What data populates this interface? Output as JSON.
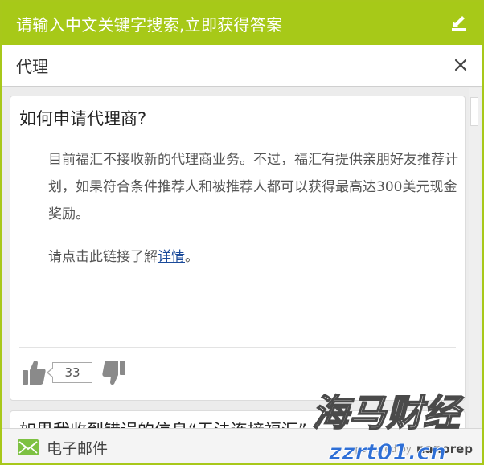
{
  "header": {
    "title": "请输入中文关键字搜索,立即获得答案",
    "minimize_icon": "minimize-icon"
  },
  "search": {
    "value": "代理",
    "clear_icon": "close-icon"
  },
  "results": [
    {
      "question": "如何申请代理商?",
      "paragraph1": "目前福汇不接收新的代理商业务。不过，福汇有提供亲朋好友推荐计划，如果符合条件推荐人和被推荐人都可以获得最高达300美元现金奖励。",
      "paragraph2_prefix": "请点击此链接了解",
      "paragraph2_link": "详情",
      "paragraph2_suffix": "。",
      "vote_count": "33"
    },
    {
      "question": "如果我收到错误的信息“无法连接福汇”"
    }
  ],
  "footer": {
    "email_label": "电子邮件",
    "powered_by": "powered by",
    "brand": "nanorep"
  },
  "watermark": {
    "line1": "海马财经",
    "line2": "zzrt01.cn"
  },
  "colors": {
    "accent": "#a7c918",
    "link": "#1a4a9a",
    "icon": "#8a8a8a"
  }
}
